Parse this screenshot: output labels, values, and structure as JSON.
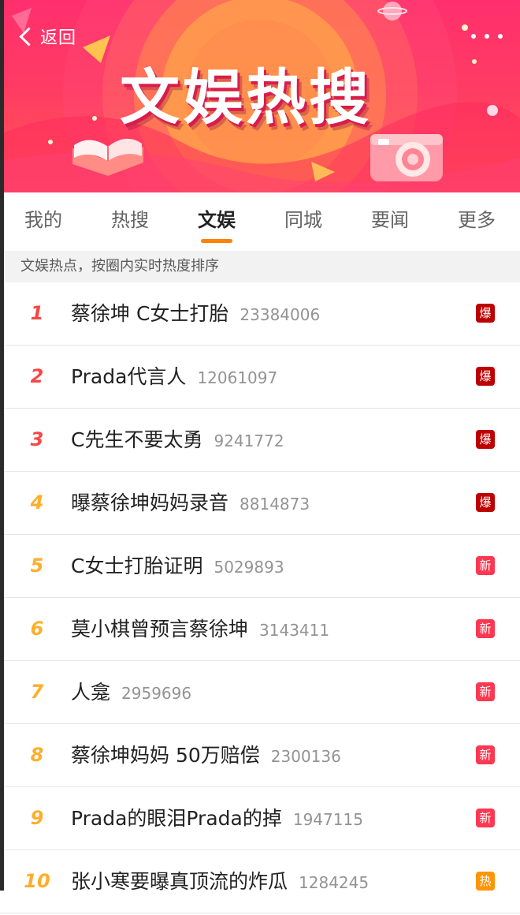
{
  "header": {
    "back_label": "返回",
    "title": "文娱热搜"
  },
  "tabs": [
    {
      "label": "我的",
      "active": false
    },
    {
      "label": "热搜",
      "active": false
    },
    {
      "label": "文娱",
      "active": true
    },
    {
      "label": "同城",
      "active": false
    },
    {
      "label": "要闻",
      "active": false
    },
    {
      "label": "更多",
      "active": false
    }
  ],
  "subheader": "文娱热点，按圈内实时热度排序",
  "icons": {
    "back": "chevron-left-icon",
    "more": "more-dots-icon",
    "book": "book-icon",
    "camera": "camera-icon"
  },
  "colors": {
    "banner_top": "#ff2f6d",
    "banner_bottom": "#ff5a55",
    "tab_accent": "#ff8200",
    "rank_top": "#f74646",
    "rank_other": "#ffae2b",
    "badge_bao": "#bd0000",
    "badge_xin": "#ff3852",
    "badge_re": "#ff9406"
  },
  "items": [
    {
      "rank": "1",
      "title": "蔡徐坤 C女士打胎",
      "count": "23384006",
      "badge": "爆",
      "badge_type": "bao"
    },
    {
      "rank": "2",
      "title": "Prada代言人",
      "count": "12061097",
      "badge": "爆",
      "badge_type": "bao"
    },
    {
      "rank": "3",
      "title": "C先生不要太勇",
      "count": "9241772",
      "badge": "爆",
      "badge_type": "bao"
    },
    {
      "rank": "4",
      "title": "曝蔡徐坤妈妈录音",
      "count": "8814873",
      "badge": "爆",
      "badge_type": "bao"
    },
    {
      "rank": "5",
      "title": "C女士打胎证明",
      "count": "5029893",
      "badge": "新",
      "badge_type": "xin"
    },
    {
      "rank": "6",
      "title": "莫小棋曾预言蔡徐坤",
      "count": "3143411",
      "badge": "新",
      "badge_type": "xin"
    },
    {
      "rank": "7",
      "title": "人龛",
      "count": "2959696",
      "badge": "新",
      "badge_type": "xin"
    },
    {
      "rank": "8",
      "title": "蔡徐坤妈妈 50万赔偿",
      "count": "2300136",
      "badge": "新",
      "badge_type": "xin"
    },
    {
      "rank": "9",
      "title": "Prada的眼泪Prada的掉",
      "count": "1947115",
      "badge": "新",
      "badge_type": "xin"
    },
    {
      "rank": "10",
      "title": "张小寒要曝真顶流的炸瓜",
      "count": "1284245",
      "badge": "热",
      "badge_type": "re"
    }
  ]
}
